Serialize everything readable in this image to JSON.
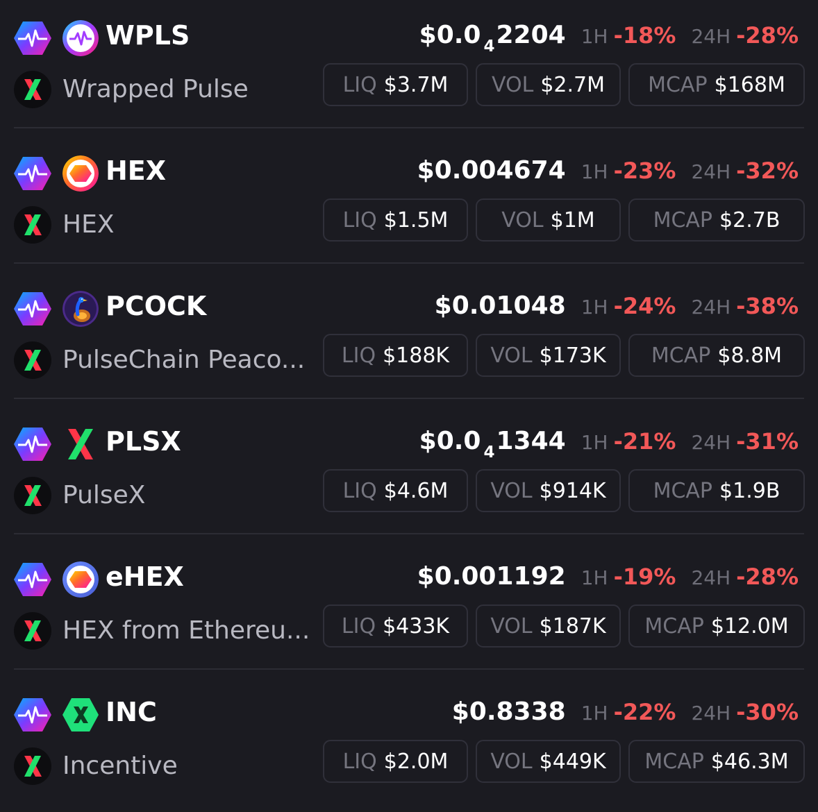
{
  "colors": {
    "background": "#1b1b21",
    "negative": "#f25858",
    "label": "#6e6e78",
    "pill_border": "#30303a"
  },
  "tokens": [
    {
      "symbol": "WPLS",
      "name": "Wrapped Pulse",
      "price_prefix": "$0.0",
      "price_subscript": "4",
      "price_main": "2204",
      "change_1h_label": "1H",
      "change_1h": "-18%",
      "change_24h_label": "24H",
      "change_24h": "-28%",
      "liq_label": "LIQ",
      "liq": "$3.7M",
      "vol_label": "VOL",
      "vol": "$2.7M",
      "mcap_label": "MCAP",
      "mcap": "$168M",
      "logo_icon": "pulse-heartbeat-icon",
      "chain_icon": "pulsechain-icon",
      "dex_icon": "pulsex-icon"
    },
    {
      "symbol": "HEX",
      "name": "HEX",
      "price_prefix": "",
      "price_subscript": "",
      "price_main": "$0.004674",
      "change_1h_label": "1H",
      "change_1h": "-23%",
      "change_24h_label": "24H",
      "change_24h": "-32%",
      "liq_label": "LIQ",
      "liq": "$1.5M",
      "vol_label": "VOL",
      "vol": "$1M",
      "mcap_label": "MCAP",
      "mcap": "$2.7B",
      "logo_icon": "hex-icon",
      "chain_icon": "pulsechain-icon",
      "dex_icon": "pulsex-icon"
    },
    {
      "symbol": "PCOCK",
      "name": "PulseChain Peaco...",
      "price_prefix": "",
      "price_subscript": "",
      "price_main": "$0.01048",
      "change_1h_label": "1H",
      "change_1h": "-24%",
      "change_24h_label": "24H",
      "change_24h": "-38%",
      "liq_label": "LIQ",
      "liq": "$188K",
      "vol_label": "VOL",
      "vol": "$173K",
      "mcap_label": "MCAP",
      "mcap": "$8.8M",
      "logo_icon": "peacock-icon",
      "chain_icon": "pulsechain-icon",
      "dex_icon": "pulsex-icon"
    },
    {
      "symbol": "PLSX",
      "name": "PulseX",
      "price_prefix": "$0.0",
      "price_subscript": "4",
      "price_main": "1344",
      "change_1h_label": "1H",
      "change_1h": "-21%",
      "change_24h_label": "24H",
      "change_24h": "-31%",
      "liq_label": "LIQ",
      "liq": "$4.6M",
      "vol_label": "VOL",
      "vol": "$914K",
      "mcap_label": "MCAP",
      "mcap": "$1.9B",
      "logo_icon": "pulsex-x-icon",
      "chain_icon": "pulsechain-icon",
      "dex_icon": "pulsex-icon"
    },
    {
      "symbol": "eHEX",
      "name": "HEX from Ethereu...",
      "price_prefix": "",
      "price_subscript": "",
      "price_main": "$0.001192",
      "change_1h_label": "1H",
      "change_1h": "-19%",
      "change_24h_label": "24H",
      "change_24h": "-28%",
      "liq_label": "LIQ",
      "liq": "$433K",
      "vol_label": "VOL",
      "vol": "$187K",
      "mcap_label": "MCAP",
      "mcap": "$12.0M",
      "logo_icon": "ehex-icon",
      "chain_icon": "pulsechain-icon",
      "dex_icon": "pulsex-icon"
    },
    {
      "symbol": "INC",
      "name": "Incentive",
      "price_prefix": "",
      "price_subscript": "",
      "price_main": "$0.8338",
      "change_1h_label": "1H",
      "change_1h": "-22%",
      "change_24h_label": "24H",
      "change_24h": "-30%",
      "liq_label": "LIQ",
      "liq": "$2.0M",
      "vol_label": "VOL",
      "vol": "$449K",
      "mcap_label": "MCAP",
      "mcap": "$46.3M",
      "logo_icon": "incentive-icon",
      "chain_icon": "pulsechain-icon",
      "dex_icon": "pulsex-icon"
    }
  ]
}
